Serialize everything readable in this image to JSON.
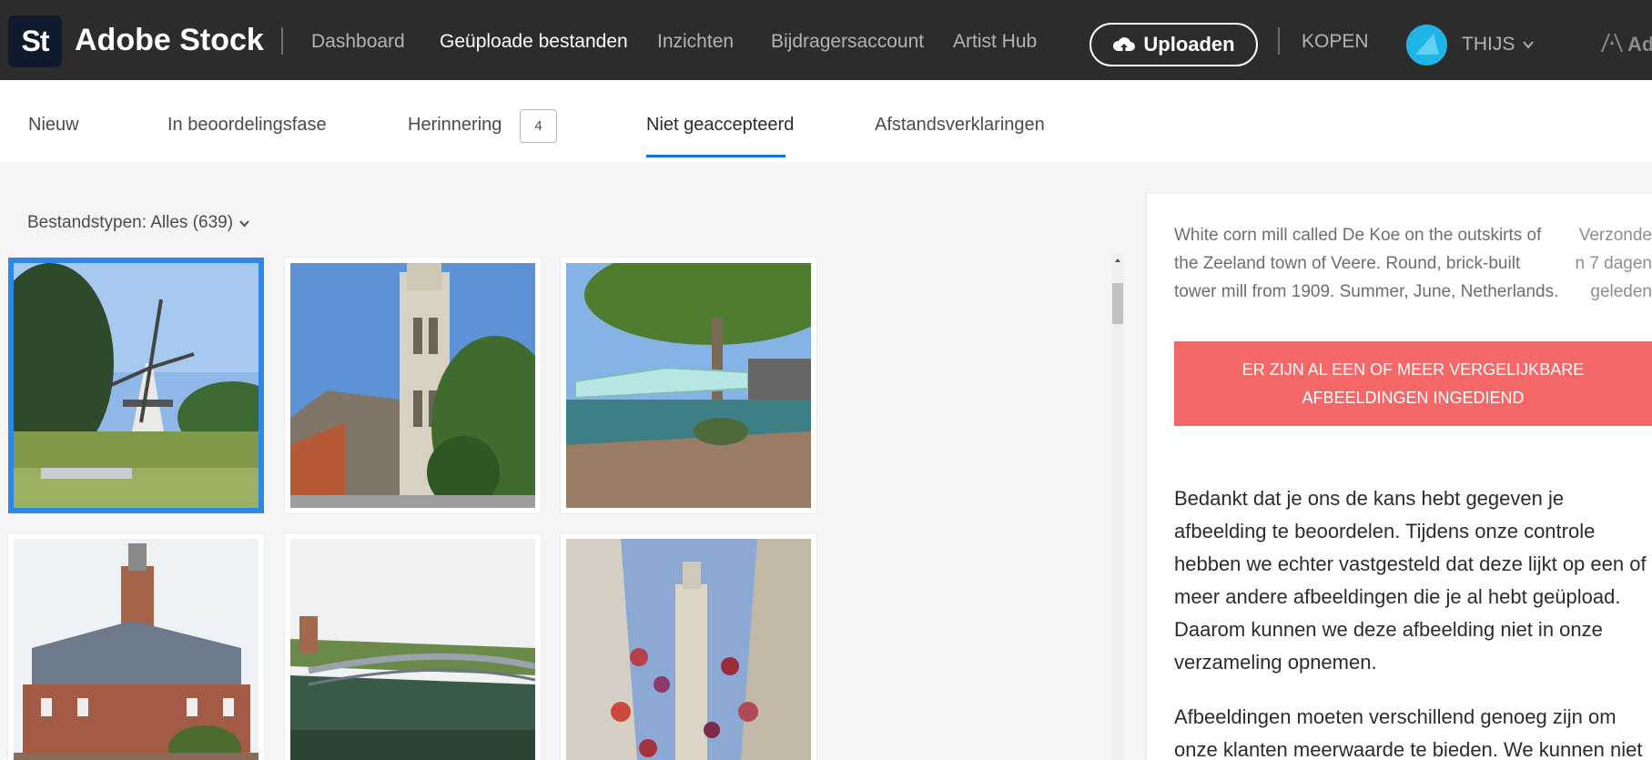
{
  "header": {
    "logo_text": "St",
    "brand": "Adobe Stock",
    "nav": [
      "Dashboard",
      "Geüploade bestanden",
      "Inzichten",
      "Bijdragersaccount",
      "Artist Hub"
    ],
    "active_nav": "Geüploade bestanden",
    "upload_label": "Uploaden",
    "buy_label": "KOPEN",
    "user_name": "THIJS",
    "adobe_text": "Ad"
  },
  "tabs": {
    "items": [
      "Nieuw",
      "In beoordelingsfase",
      "Herinnering",
      "Niet geaccepteerd",
      "Afstandsverklaringen"
    ],
    "reminder_count": "4",
    "active": "Niet geaccepteerd"
  },
  "filter": {
    "label": "Bestandstypen: Alles (639)"
  },
  "thumbnails": [
    {
      "subject": "windmill",
      "selected": true
    },
    {
      "subject": "church-tower",
      "selected": false
    },
    {
      "subject": "bridge-tree",
      "selected": false
    },
    {
      "subject": "abbey-building",
      "selected": false
    },
    {
      "subject": "footbridge",
      "selected": false
    },
    {
      "subject": "alley-tower",
      "selected": false
    }
  ],
  "detail": {
    "description_lines": [
      "White corn mill called De Koe on the outskirts of",
      "the Zeeland town of Veere. Round, brick-built",
      "tower mill from 1909. Summer, June, Netherlands."
    ],
    "sent_lines": [
      "Verzonde",
      "n 7 dagen",
      "geleden"
    ],
    "rejection_reason_lines": [
      "ER ZIJN AL EEN OF MEER VERGELIJKBARE",
      "AFBEELDINGEN INGEDIEND"
    ],
    "body_lines": [
      "Bedankt dat je ons de kans hebt gegeven je",
      "afbeelding te beoordelen. Tijdens onze controle",
      "hebben we echter vastgesteld dat deze lijkt op een of",
      "meer andere afbeeldingen die je al hebt geüpload.",
      "Daarom kunnen we deze afbeelding niet in onze",
      "verzameling opnemen.",
      "Afbeeldingen moeten verschillend genoeg zijn om",
      "onze klanten meerwaarde te bieden. We kunnen niet"
    ]
  },
  "colors": {
    "topbar": "#2c2c2c",
    "accent": "#1473e6",
    "selected_border": "#2d87e8",
    "alert": "#f46868",
    "avatar": "#1fb4e6"
  }
}
